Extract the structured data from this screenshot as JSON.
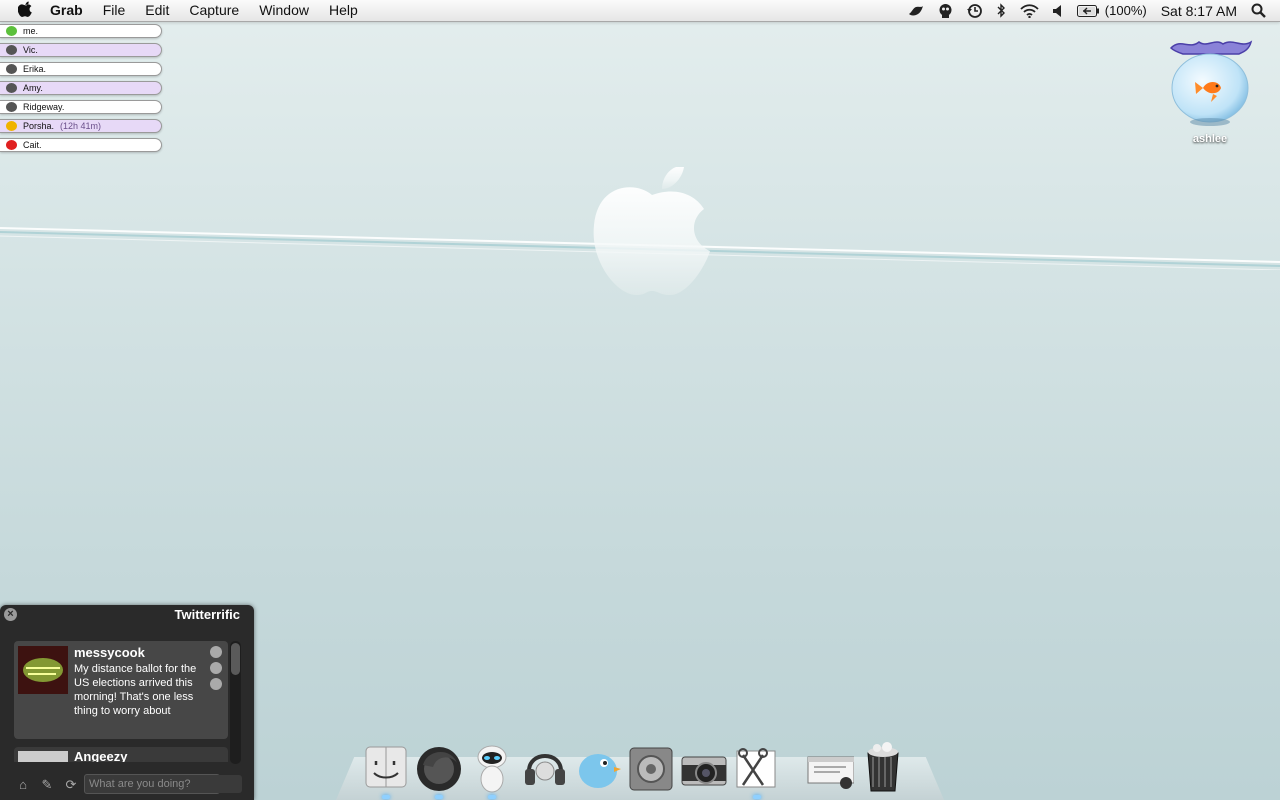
{
  "menubar": {
    "app_name": "Grab",
    "menus": [
      "File",
      "Edit",
      "Capture",
      "Window",
      "Help"
    ],
    "battery": "(100%)",
    "clock": "Sat 8:17 AM",
    "status_icons": [
      "twitter-bird-icon",
      "robot-icon",
      "time-machine-icon",
      "bluetooth-icon",
      "wifi-icon",
      "volume-icon",
      "battery-icon",
      "spotlight-icon"
    ]
  },
  "contacts": [
    {
      "name": "me.",
      "status_color": "#5cc03c",
      "extra": ""
    },
    {
      "name": "Vic.",
      "status_color": "#555555",
      "extra": ""
    },
    {
      "name": "Erika.",
      "status_color": "#555555",
      "extra": ""
    },
    {
      "name": "Amy.",
      "status_color": "#555555",
      "extra": ""
    },
    {
      "name": "Ridgeway.",
      "status_color": "#555555",
      "extra": ""
    },
    {
      "name": "Porsha.",
      "status_color": "#f0b300",
      "extra": "(12h 41m)"
    },
    {
      "name": "Cait.",
      "status_color": "#e02020",
      "extra": ""
    }
  ],
  "desktop_icon": {
    "label": "ashlee"
  },
  "twitterrific": {
    "title": "Twitterrific",
    "tweets": [
      {
        "user": "messycook",
        "text": "My distance ballot for the US elections arrived this morning! That's one less thing to worry about"
      },
      {
        "user": "Angeezy",
        "text": ""
      }
    ],
    "input_placeholder": "What are you doing?"
  },
  "dock": {
    "items": [
      {
        "name": "finder",
        "running": true
      },
      {
        "name": "firefox",
        "running": true
      },
      {
        "name": "eve-robot",
        "running": true
      },
      {
        "name": "headphones",
        "running": false
      },
      {
        "name": "twitterrific",
        "running": false
      },
      {
        "name": "system-preferences",
        "running": false
      },
      {
        "name": "camera",
        "running": false
      },
      {
        "name": "grab",
        "running": true
      },
      {
        "name": "screenshot-window",
        "running": false
      },
      {
        "name": "trash",
        "running": false
      }
    ]
  },
  "colors": {
    "contact_alt_bg": "#e7d9f7",
    "twit_bg": "#2a2a2a"
  }
}
